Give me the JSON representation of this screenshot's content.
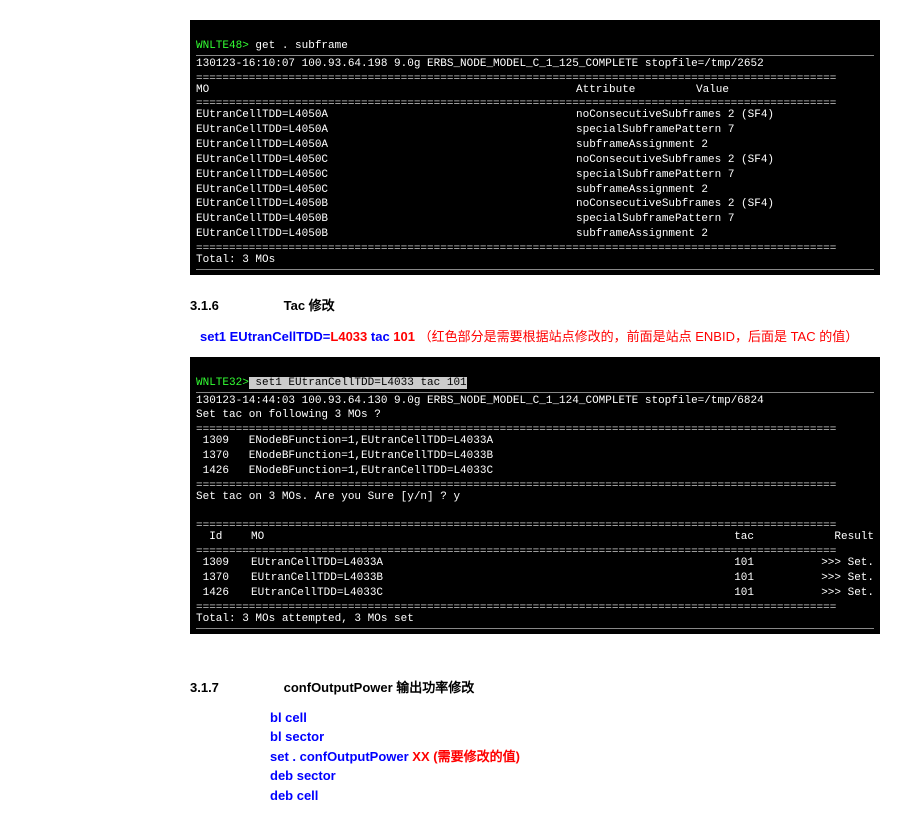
{
  "term1": {
    "prompt": "WNLTE48>",
    "cmd": " get . subframe",
    "status": "130123-16:10:07 100.93.64.198 9.0g ERBS_NODE_MODEL_C_1_125_COMPLETE stopfile=/tmp/2652",
    "hdr_mo": "MO",
    "hdr_attr": "Attribute",
    "hdr_val": "Value",
    "rows": [
      {
        "mo": "EUtranCellTDD=L4050A",
        "attr": "noConsecutiveSubframes 2 (SF4)"
      },
      {
        "mo": "EUtranCellTDD=L4050A",
        "attr": "specialSubframePattern 7"
      },
      {
        "mo": "EUtranCellTDD=L4050A",
        "attr": "subframeAssignment 2"
      },
      {
        "mo": "EUtranCellTDD=L4050C",
        "attr": "noConsecutiveSubframes 2 (SF4)"
      },
      {
        "mo": "EUtranCellTDD=L4050C",
        "attr": "specialSubframePattern 7"
      },
      {
        "mo": "EUtranCellTDD=L4050C",
        "attr": "subframeAssignment 2"
      },
      {
        "mo": "EUtranCellTDD=L4050B",
        "attr": "noConsecutiveSubframes 2 (SF4)"
      },
      {
        "mo": "EUtranCellTDD=L4050B",
        "attr": "specialSubframePattern 7"
      },
      {
        "mo": "EUtranCellTDD=L4050B",
        "attr": "subframeAssignment 2"
      }
    ],
    "total": "Total: 3 MOs"
  },
  "sec316": {
    "num": "3.1.6",
    "title": "Tac 修改",
    "cmd_pre": "set1 EUtranCellTDD=",
    "cmd_red1": "L4033",
    "cmd_mid": " tac ",
    "cmd_red2": "101",
    "note": " （红色部分是需要根据站点修改的，前面是站点 ENBID，后面是 TAC 的值）"
  },
  "term2": {
    "prompt": "WNLTE32>",
    "cmd": " set1 EUtranCellTDD=L4033 tac 101",
    "status": "130123-14:44:03 100.93.64.130 9.0g ERBS_NODE_MODEL_C_1_124_COMPLETE stopfile=/tmp/6824",
    "following": "Set tac on following 3 MOs ?",
    "list": [
      {
        "id": " 1309",
        "mo": "ENodeBFunction=1,EUtranCellTDD=L4033A"
      },
      {
        "id": " 1370",
        "mo": "ENodeBFunction=1,EUtranCellTDD=L4033B"
      },
      {
        "id": " 1426",
        "mo": "ENodeBFunction=1,EUtranCellTDD=L4033C"
      }
    ],
    "confirm": "Set tac on 3 MOs. Are you Sure [y/n] ? y",
    "hdr_id": "  Id",
    "hdr_mo": "MO",
    "hdr_tac": "tac",
    "hdr_res": "Result",
    "rows": [
      {
        "id": " 1309",
        "mo": "EUtranCellTDD=L4033A",
        "tac": "101",
        "res": ">>> Set."
      },
      {
        "id": " 1370",
        "mo": "EUtranCellTDD=L4033B",
        "tac": "101",
        "res": ">>> Set."
      },
      {
        "id": " 1426",
        "mo": "EUtranCellTDD=L4033C",
        "tac": "101",
        "res": ">>> Set."
      }
    ],
    "total": "Total: 3 MOs attempted, 3 MOs set"
  },
  "sec317": {
    "num": "3.1.7",
    "title": "confOutputPower 输出功率修改",
    "l1": "bl  cell",
    "l2": "bl  sector",
    "l3a": "set  .  confOutputPower   ",
    "l3b": "XX (需要修改的值)",
    "l4": "deb sector",
    "l5": "deb cell"
  },
  "dline": "================================================================================================="
}
